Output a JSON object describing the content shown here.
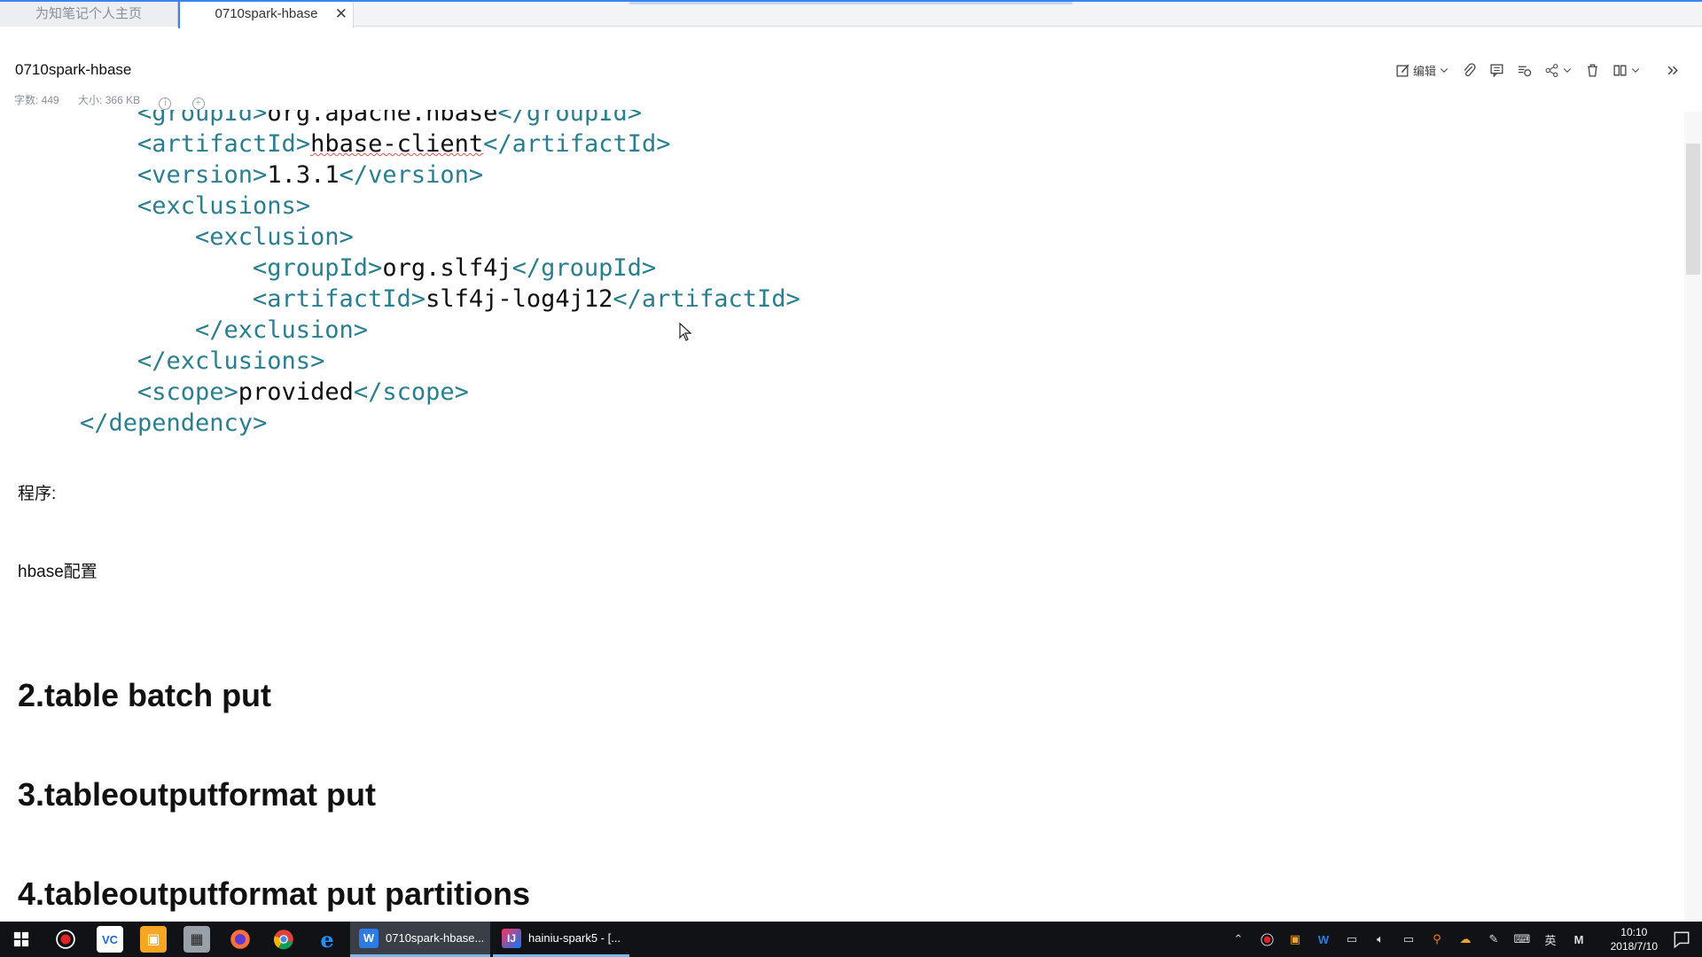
{
  "tabs": [
    {
      "label": "为知笔记个人主页"
    },
    {
      "label": "0710spark-hbase",
      "close": "✕"
    }
  ],
  "note": {
    "title": "0710spark-hbase",
    "word_count": "字数: 449",
    "size": "大小: 366 KB"
  },
  "toolbar": {
    "edit_label": "编辑"
  },
  "code_lines": [
    {
      "open": "<groupId>",
      "text": "org.apache.hbase",
      "close": "</groupId>"
    },
    {
      "open": "<artifactId>",
      "text": "hbase-client",
      "close": "</artifactId>"
    },
    {
      "open": "<version>",
      "text": "1.3.1",
      "close": "</version>"
    },
    {
      "open": "<exclusions>",
      "text": "",
      "close": ""
    },
    {
      "open": "<exclusion>",
      "text": "",
      "close": ""
    },
    {
      "open": "<groupId>",
      "text": "org.slf4j",
      "close": "</groupId>"
    },
    {
      "open": "<artifactId>",
      "text": "slf4j-log4j12",
      "close": "</artifactId>"
    },
    {
      "open": "</exclusion>",
      "text": "",
      "close": ""
    },
    {
      "open": "</exclusions>",
      "text": "",
      "close": ""
    },
    {
      "open": "<scope>",
      "text": "provided",
      "close": "</scope>"
    },
    {
      "open": "</dependency>",
      "text": "",
      "close": ""
    }
  ],
  "paragraphs": {
    "program": "程序:",
    "hbase_config": "hbase配置"
  },
  "headings": {
    "h2_batch": "2.table batch put",
    "h3_outputformat": "3.tableoutputformat put",
    "h4_partitions": "4.tableoutputformat put partitions"
  },
  "taskbar": {
    "apps": [
      {
        "label": "0710spark-hbase..."
      },
      {
        "label": "hainiu-spark5 - [..."
      }
    ],
    "ime": "英",
    "clock_time": "10:10",
    "clock_date": "2018/7/10"
  },
  "colors": {
    "tag": "#2a7f8f",
    "accent": "#3b82f6",
    "taskbar": "#101216"
  }
}
